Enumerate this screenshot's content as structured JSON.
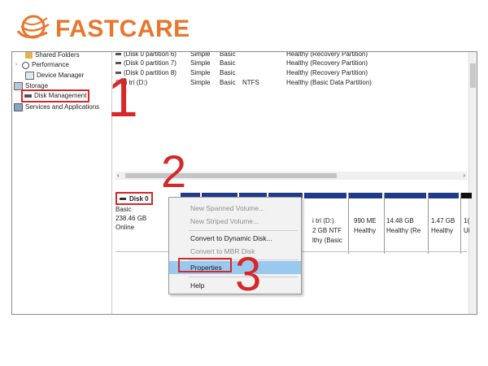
{
  "logo": {
    "text": "FASTCARE",
    "color": "#e8762d"
  },
  "tree": {
    "items": [
      {
        "label": "Shared Folders",
        "icon": "folder-icon"
      },
      {
        "label": "Performance",
        "icon": "performance-icon"
      },
      {
        "label": "Device Manager",
        "icon": "device-manager-icon"
      },
      {
        "label": "Storage",
        "icon": "storage-icon"
      },
      {
        "label": "Disk Management",
        "icon": "disk-icon"
      },
      {
        "label": "Services and Applications",
        "icon": "services-icon"
      }
    ]
  },
  "volumes": [
    {
      "name": "(Disk 0 partition 6)",
      "layout": "Simple",
      "type": "Basic",
      "fs": "",
      "status": "Healthy (Recovery Partition)"
    },
    {
      "name": "(Disk 0 partition 7)",
      "layout": "Simple",
      "type": "Basic",
      "fs": "",
      "status": "Healthy (Recovery Partition)"
    },
    {
      "name": "(Disk 0 partition 8)",
      "layout": "Simple",
      "type": "Basic",
      "fs": "",
      "status": "Healthy (Recovery Partition)"
    },
    {
      "name": "Giải trí (D:)",
      "layout": "Simple",
      "type": "Basic",
      "fs": "NTFS",
      "status": "Healthy (Basic Data Partition)"
    }
  ],
  "scroll": {
    "left": "‹",
    "right": "›"
  },
  "disk": {
    "name": "Disk 0",
    "type": "Basic",
    "size": "238.46 GB",
    "status": "Online"
  },
  "partitions": [
    {
      "line1": "i trí  (D:)",
      "line2": "2 GB NTF",
      "line3": "lthy (Basic"
    },
    {
      "line1": "",
      "line2": "990 ME",
      "line3": "Healthy"
    },
    {
      "line1": "",
      "line2": "14.48 GB",
      "line3": "Healthy (Re"
    },
    {
      "line1": "",
      "line2": "1.47 GB",
      "line3": "Healthy"
    },
    {
      "line1": "",
      "line2": "1(",
      "line3": "Ui"
    }
  ],
  "menu": {
    "new_spanned": "New Spanned Volume...",
    "new_striped": "New Striped Volume...",
    "convert_dynamic": "Convert to Dynamic Disk...",
    "convert_mbr": "Convert to MBR Disk",
    "properties": "Properties",
    "help": "Help"
  },
  "annotations": {
    "one": "1",
    "two": "2",
    "three": "3",
    "color": "#d62828"
  }
}
